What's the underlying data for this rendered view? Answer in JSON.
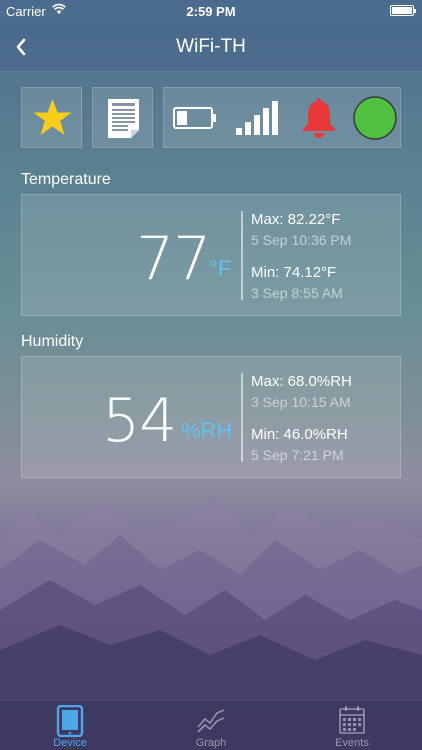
{
  "status_bar": {
    "carrier": "Carrier",
    "time": "2:59 PM"
  },
  "nav": {
    "title": "WiFi-TH"
  },
  "temperature": {
    "label": "Temperature",
    "value": "77",
    "unit": "°F",
    "max_label": "Max: 82.22°F",
    "max_time": "5 Sep 10:36 PM",
    "min_label": "Min: 74.12°F",
    "min_time": "3 Sep 8:55 AM"
  },
  "humidity": {
    "label": "Humidity",
    "value": "54",
    "unit": "%RH",
    "max_label": "Max: 68.0%RH",
    "max_time": "3 Sep 10:15 AM",
    "min_label": "Min: 46.0%RH",
    "min_time": "5 Sep 7:21 PM"
  },
  "tabs": [
    {
      "label": "Device",
      "active": true
    },
    {
      "label": "Graph",
      "active": false
    },
    {
      "label": "Events",
      "active": false
    }
  ],
  "icons": {
    "favorite": "star-icon",
    "report": "document-icon",
    "battery": "battery-icon",
    "signal": "signal-icon",
    "alarm": "bell-icon",
    "status": "online-status-icon"
  },
  "colors": {
    "accent": "#4fa6e8",
    "unit": "#5fc4f0",
    "star": "#f5cd1a",
    "alarm": "#e8393a",
    "status": "#4fc03f"
  }
}
